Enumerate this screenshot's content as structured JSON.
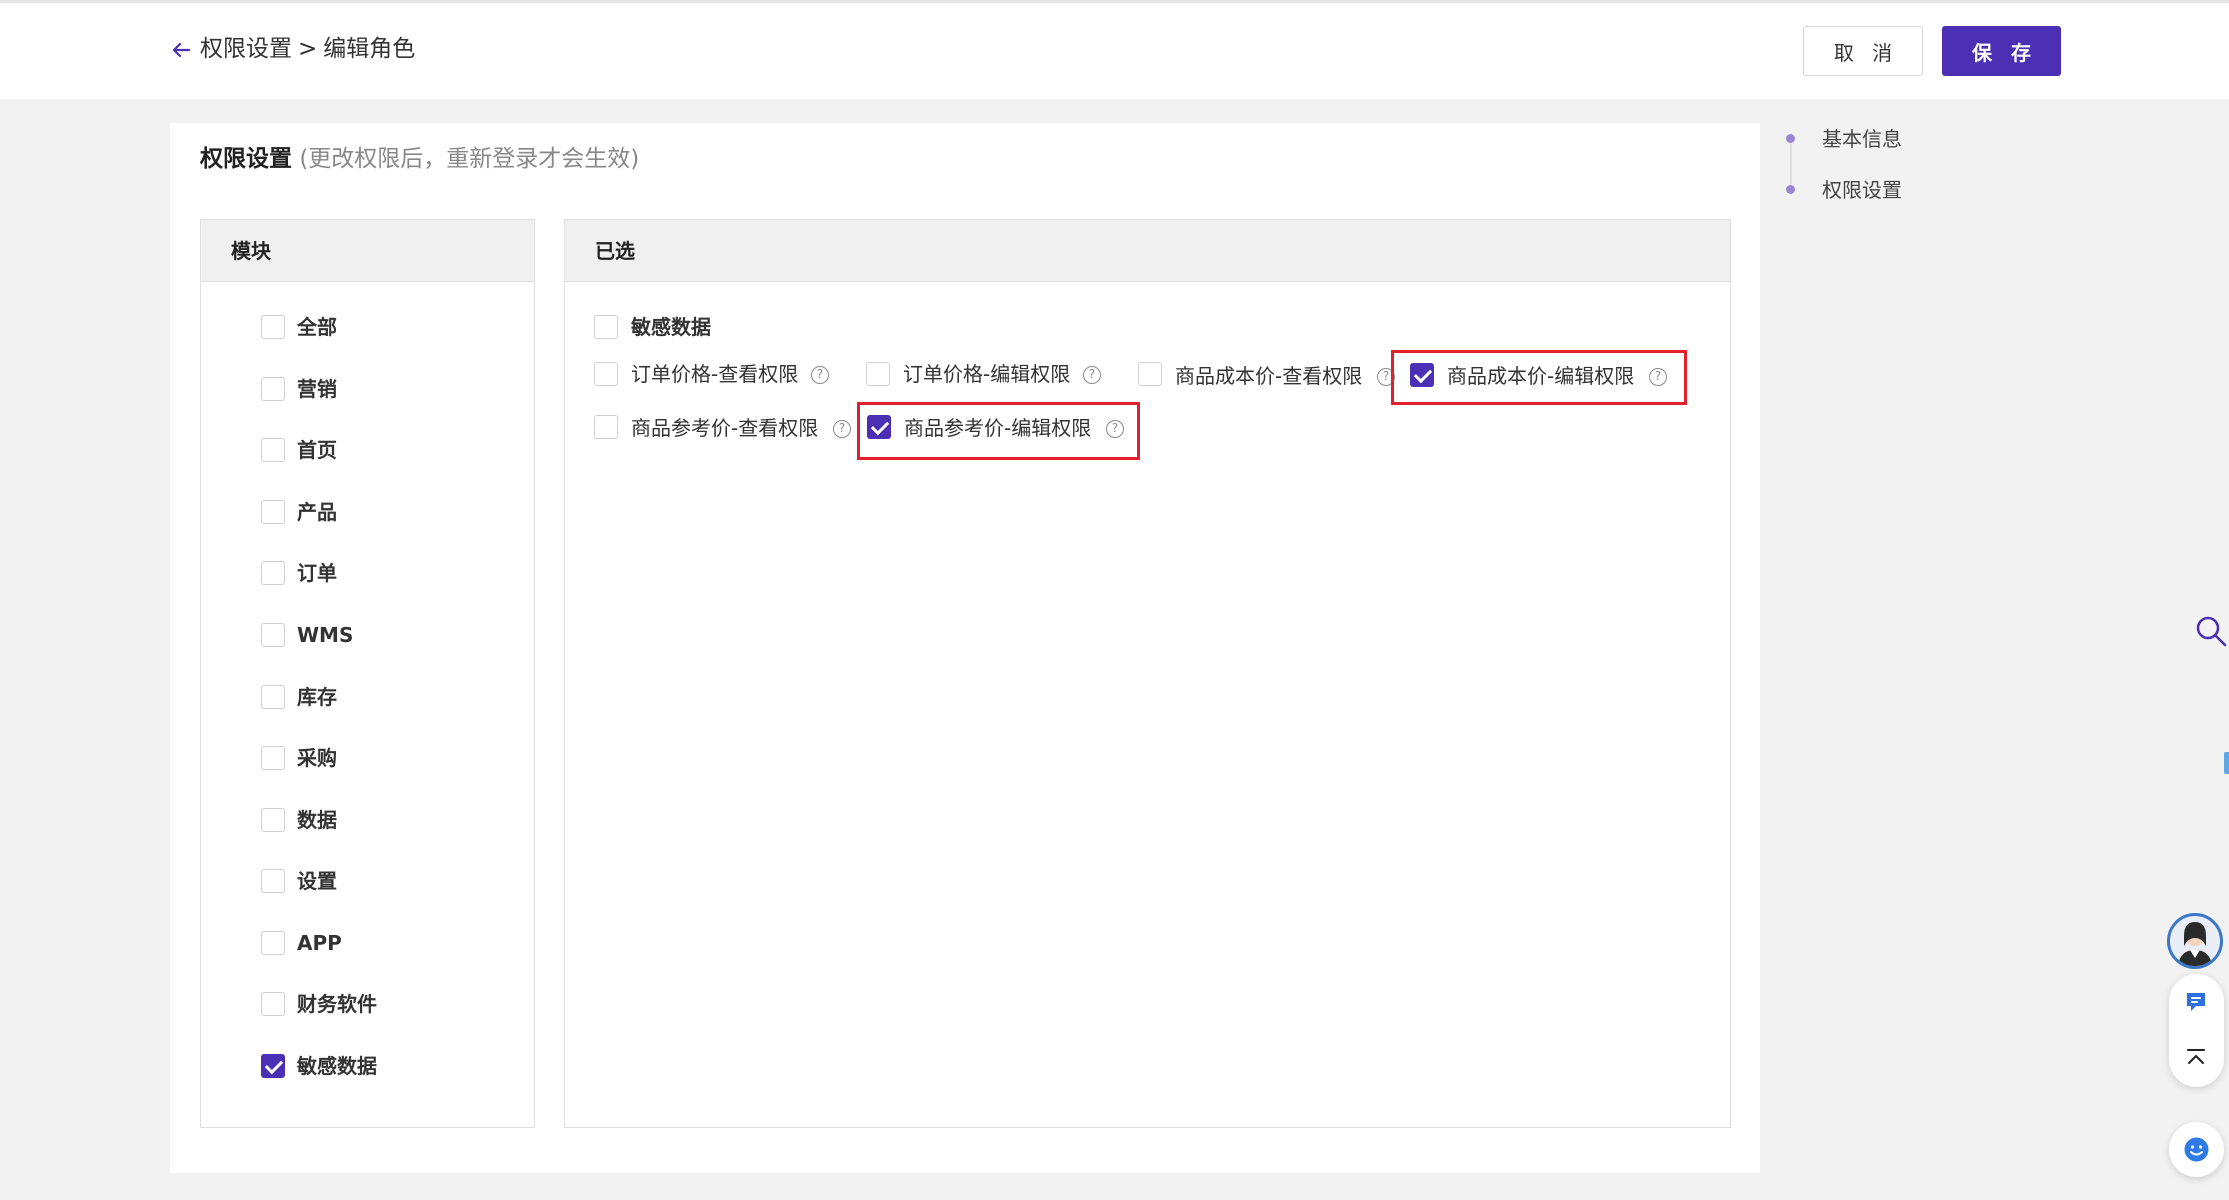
{
  "header": {
    "breadcrumb_parent": "权限设置",
    "breadcrumb_sep": ">",
    "breadcrumb_current": "编辑角色",
    "cancel_label": "取 消",
    "save_label": "保 存"
  },
  "section": {
    "title": "权限设置",
    "note": "(更改权限后，重新登录才会生效)"
  },
  "modules": {
    "header": "模块",
    "items": [
      {
        "label": "全部",
        "checked": false
      },
      {
        "label": "营销",
        "checked": false
      },
      {
        "label": "首页",
        "checked": false
      },
      {
        "label": "产品",
        "checked": false
      },
      {
        "label": "订单",
        "checked": false
      },
      {
        "label": "WMS",
        "checked": false
      },
      {
        "label": "库存",
        "checked": false
      },
      {
        "label": "采购",
        "checked": false
      },
      {
        "label": "数据",
        "checked": false
      },
      {
        "label": "设置",
        "checked": false
      },
      {
        "label": "APP",
        "checked": false
      },
      {
        "label": "财务软件",
        "checked": false
      },
      {
        "label": "敏感数据",
        "checked": true
      }
    ]
  },
  "selected": {
    "header": "已选",
    "group_label": "敏感数据",
    "permissions": [
      {
        "label": "订单价格-查看权限",
        "checked": false
      },
      {
        "label": "订单价格-编辑权限",
        "checked": false
      },
      {
        "label": "商品成本价-查看权限",
        "checked": false
      },
      {
        "label": "商品成本价-编辑权限",
        "checked": true
      },
      {
        "label": "商品参考价-查看权限",
        "checked": false
      },
      {
        "label": "商品参考价-编辑权限",
        "checked": true
      }
    ],
    "help_glyph": "?"
  },
  "anchor_nav": {
    "items": [
      "基本信息",
      "权限设置"
    ]
  },
  "colors": {
    "primary": "#4b2fb5",
    "highlight_box": "#e0202a"
  },
  "icons": [
    "back-arrow-icon",
    "help-icon",
    "search-icon",
    "chat-icon",
    "back-to-top-icon",
    "smile-icon"
  ]
}
